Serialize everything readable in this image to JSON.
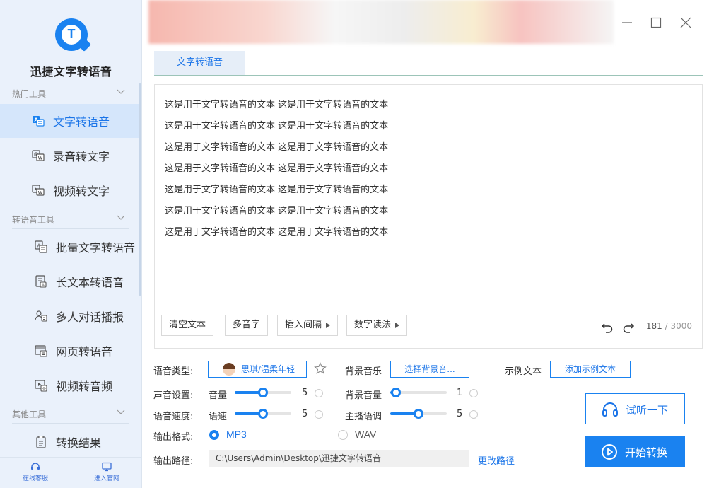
{
  "app": {
    "title": "迅捷文字转语音"
  },
  "sidebar": {
    "sections": [
      {
        "label": "热门工具"
      },
      {
        "label": "转语音工具"
      },
      {
        "label": "其他工具"
      }
    ],
    "items": [
      {
        "label": "文字转语音",
        "icon": "text-to-speech-icon",
        "active": true
      },
      {
        "label": "录音转文字",
        "icon": "audio-to-text-icon"
      },
      {
        "label": "视频转文字",
        "icon": "video-to-text-icon"
      },
      {
        "label": "批量文字转语音",
        "icon": "batch-text-icon"
      },
      {
        "label": "长文本转语音",
        "icon": "long-text-icon"
      },
      {
        "label": "多人对话播报",
        "icon": "multi-speaker-icon"
      },
      {
        "label": "网页转语音",
        "icon": "webpage-icon"
      },
      {
        "label": "视频转音频",
        "icon": "video-to-audio-icon"
      },
      {
        "label": "转换结果",
        "icon": "result-icon"
      }
    ],
    "bottom_links": [
      {
        "label": "在线客服",
        "icon": "headset-icon"
      },
      {
        "label": "进入官网",
        "icon": "monitor-icon"
      }
    ]
  },
  "tabs": [
    {
      "label": "文字转语音",
      "active": true
    }
  ],
  "editor": {
    "lines": [
      "这是用于文字转语音的文本 这是用于文字转语音的文本",
      "这是用于文字转语音的文本 这是用于文字转语音的文本",
      "这是用于文字转语音的文本 这是用于文字转语音的文本",
      "这是用于文字转语音的文本 这是用于文字转语音的文本",
      "这是用于文字转语音的文本 这是用于文字转语音的文本",
      "这是用于文字转语音的文本 这是用于文字转语音的文本",
      "这是用于文字转语音的文本 这是用于文字转语音的文本"
    ],
    "toolbar": {
      "clear": "清空文本",
      "polyphone": "多音字",
      "insert_pause": "插入间隔",
      "number_reading": "数字读法"
    },
    "char_count": "181",
    "char_max": "/ 3000"
  },
  "settings": {
    "voice_type_label": "语音类型:",
    "voice_name": "思琪/温柔年轻",
    "bg_music_label": "背景音乐",
    "bg_music_button": "选择背景音...",
    "sample_text_label": "示例文本",
    "sample_text_button": "添加示例文本",
    "sound_settings_label": "声音设置:",
    "volume_label": "音量",
    "volume_value": 5,
    "bg_volume_label": "背景音量",
    "bg_volume_value": 1,
    "speed_label": "语音速度:",
    "speed_sub_label": "语速",
    "speed_value": 5,
    "pitch_label": "主播语调",
    "pitch_value": 5,
    "slider_max": 10,
    "format_label": "输出格式:",
    "formats": [
      {
        "label": "MP3",
        "selected": true
      },
      {
        "label": "WAV",
        "selected": false
      }
    ],
    "path_label": "输出路径:",
    "path_value": "C:\\Users\\Admin\\Desktop\\迅捷文字转语音",
    "change_path": "更改路径"
  },
  "actions": {
    "listen": "试听一下",
    "start": "开始转换"
  },
  "colors": {
    "accent": "#1a82f0",
    "sidebar_bg": "#eaf1fb",
    "active_bg": "#d5e6fb"
  }
}
